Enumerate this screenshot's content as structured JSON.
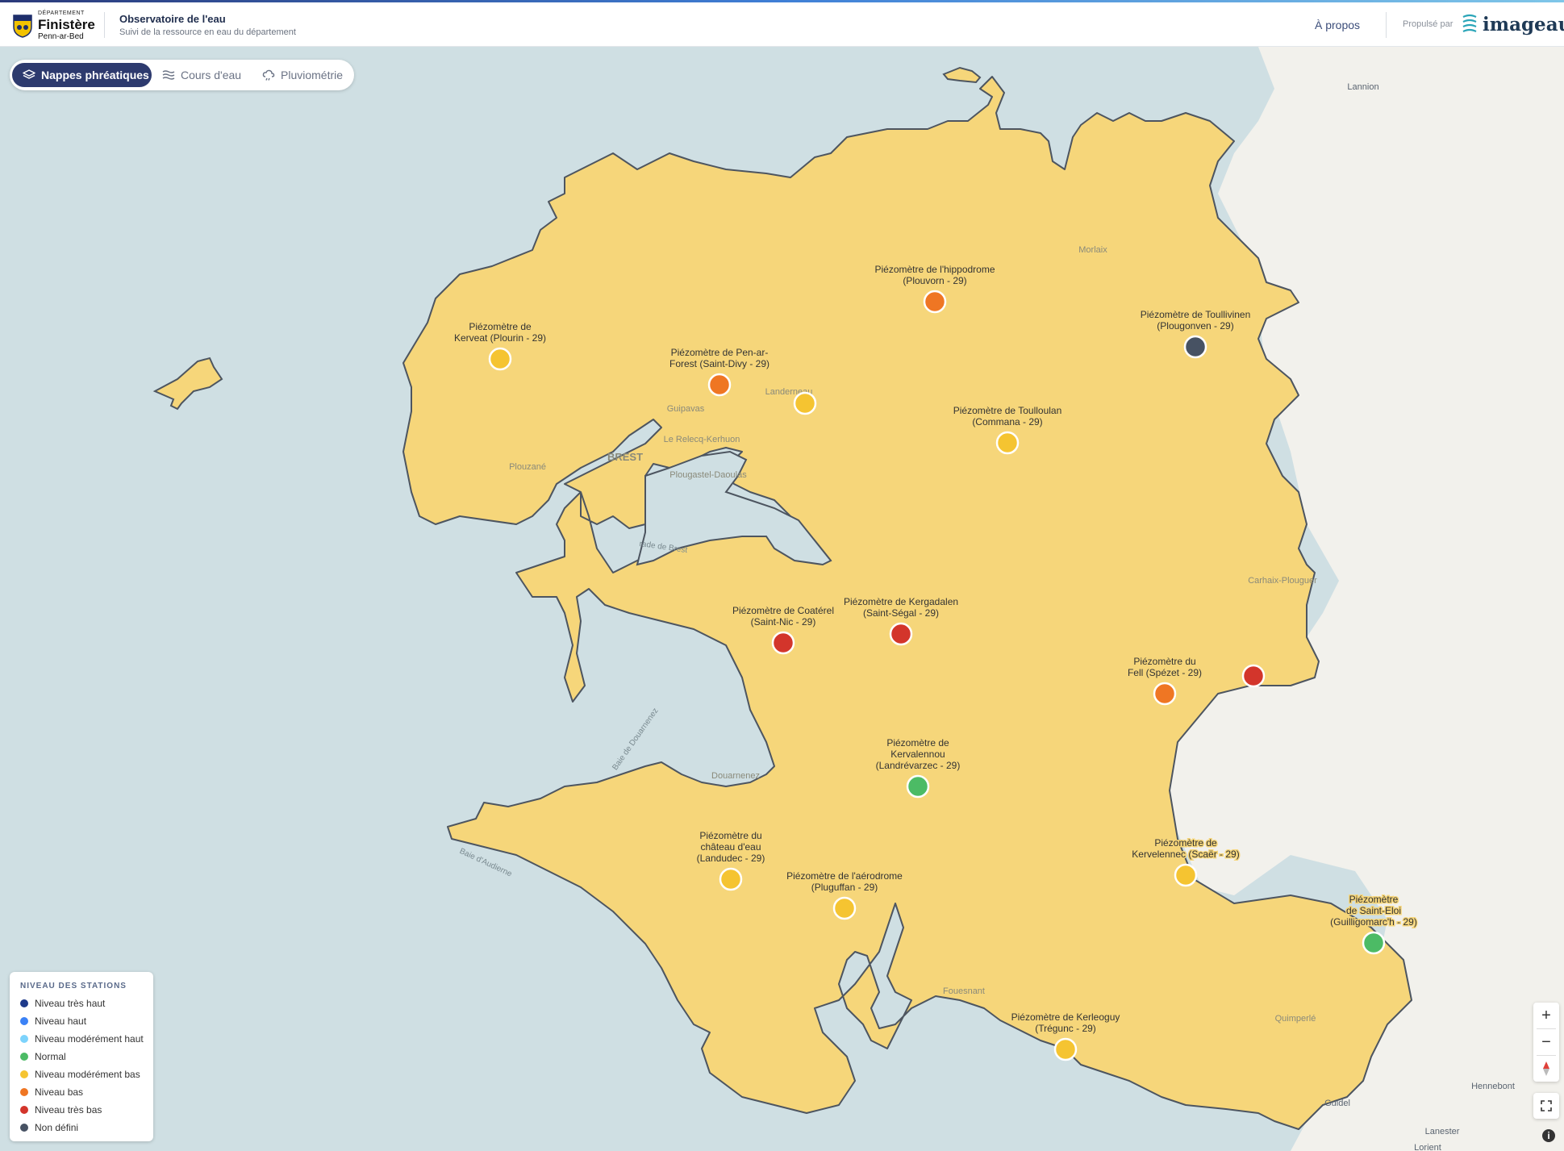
{
  "header": {
    "logo": {
      "small": "DÉPARTEMENT",
      "main": "Finistère",
      "sub": "Penn-ar-Bed"
    },
    "app_title": "Observatoire de l'eau",
    "app_subtitle": "Suivi de la ressource en eau du département",
    "about_link": "À propos",
    "powered_by": "Propulsé par",
    "brand": "imageau"
  },
  "tabs": [
    {
      "label": "Nappes phréatiques",
      "icon": "layers-icon",
      "active": true
    },
    {
      "label": "Cours d'eau",
      "icon": "waves-icon",
      "active": false
    },
    {
      "label": "Pluviométrie",
      "icon": "rain-cloud-icon",
      "active": false
    }
  ],
  "colors": {
    "tres_haut": "#1e3a8a",
    "haut": "#3b82f6",
    "moderement_haut": "#7dd3fc",
    "normal": "#4cbb65",
    "moderement_bas": "#f5c431",
    "bas": "#ef7623",
    "tres_bas": "#d3352b",
    "non_defini": "#475263",
    "department_fill": "#f6d67a",
    "sea": "#cfdfe3",
    "land": "#f2f1ec"
  },
  "legend": {
    "title": "NIVEAU DES STATIONS",
    "items": [
      {
        "label": "Niveau très haut",
        "color": "#1e3a8a"
      },
      {
        "label": "Niveau haut",
        "color": "#3b82f6"
      },
      {
        "label": "Niveau modérément haut",
        "color": "#7dd3fc"
      },
      {
        "label": "Normal",
        "color": "#4cbb65"
      },
      {
        "label": "Niveau modérément bas",
        "color": "#f5c431"
      },
      {
        "label": "Niveau bas",
        "color": "#ef7623"
      },
      {
        "label": "Niveau très bas",
        "color": "#d3352b"
      },
      {
        "label": "Non défini",
        "color": "#475263"
      }
    ]
  },
  "stations": [
    {
      "lines": [
        "Piézomètre de",
        "Kerveat (Plourin - 29)"
      ],
      "level": "Niveau modérément bas"
    },
    {
      "lines": [
        "Piézomètre de l'hippodrome",
        "(Plouvorn - 29)"
      ],
      "level": "Niveau bas"
    },
    {
      "lines": [
        "Piézomètre de Toullivinen",
        "(Plougonven - 29)"
      ],
      "level": "Non défini"
    },
    {
      "lines": [
        "Piézomètre de Pen-ar-",
        "Forest (Saint-Divy - 29)"
      ],
      "level": "Niveau bas"
    },
    {
      "lines": [],
      "level": "Niveau modérément bas"
    },
    {
      "lines": [
        "Piézomètre de Toulloulan",
        "(Commana - 29)"
      ],
      "level": "Niveau modérément bas"
    },
    {
      "lines": [
        "Piézomètre de Coatérel",
        "(Saint-Nic - 29)"
      ],
      "level": "Niveau très bas"
    },
    {
      "lines": [
        "Piézomètre de Kergadalen",
        "(Saint-Ségal - 29)"
      ],
      "level": "Niveau très bas"
    },
    {
      "lines": [
        "Piézomètre du",
        "Fell (Spézet - 29)"
      ],
      "level": "Niveau bas"
    },
    {
      "lines": [],
      "level": "Niveau très bas"
    },
    {
      "lines": [
        "Piézomètre de",
        "Kervalennou",
        "(Landrévarzec - 29)"
      ],
      "level": "Normal"
    },
    {
      "lines": [
        "Piézomètre du",
        "château d'eau",
        "(Landudec - 29)"
      ],
      "level": "Niveau modérément bas"
    },
    {
      "lines": [
        "Piézomètre de l'aérodrome",
        "(Pluguffan - 29)"
      ],
      "level": "Niveau modérément bas"
    },
    {
      "lines": [
        "Piézomètre de",
        "Kervelennec (Scaër - 29)"
      ],
      "level": "Niveau modérément bas"
    },
    {
      "lines": [
        "Piézomètre",
        "de Saint-Eloi",
        "(Guilligomarc'h - 29)"
      ],
      "level": "Normal"
    },
    {
      "lines": [
        "Piézomètre de Kerleoguy",
        "(Trégunc - 29)"
      ],
      "level": "Niveau modérément bas"
    }
  ],
  "places": [
    {
      "name": "Lannion"
    },
    {
      "name": "Morlaix"
    },
    {
      "name": "Guipavas"
    },
    {
      "name": "Landerneau"
    },
    {
      "name": "Le Relecq-Kerhuon"
    },
    {
      "name": "BREST"
    },
    {
      "name": "Plouzané"
    },
    {
      "name": "Plougastel-Daoulas"
    },
    {
      "name": "rade de Brest"
    },
    {
      "name": "Carhaix-Plouguer"
    },
    {
      "name": "Baie de Douarnenez"
    },
    {
      "name": "Douarnenez"
    },
    {
      "name": "Baie d'Audierne"
    },
    {
      "name": "Fouesnant"
    },
    {
      "name": "Quimperlé"
    },
    {
      "name": "Hennebont"
    },
    {
      "name": "Guidel"
    },
    {
      "name": "Lanester"
    },
    {
      "name": "Lorient"
    }
  ],
  "controls": {
    "zoom_in": "+",
    "zoom_out": "−",
    "attribution": "i"
  }
}
